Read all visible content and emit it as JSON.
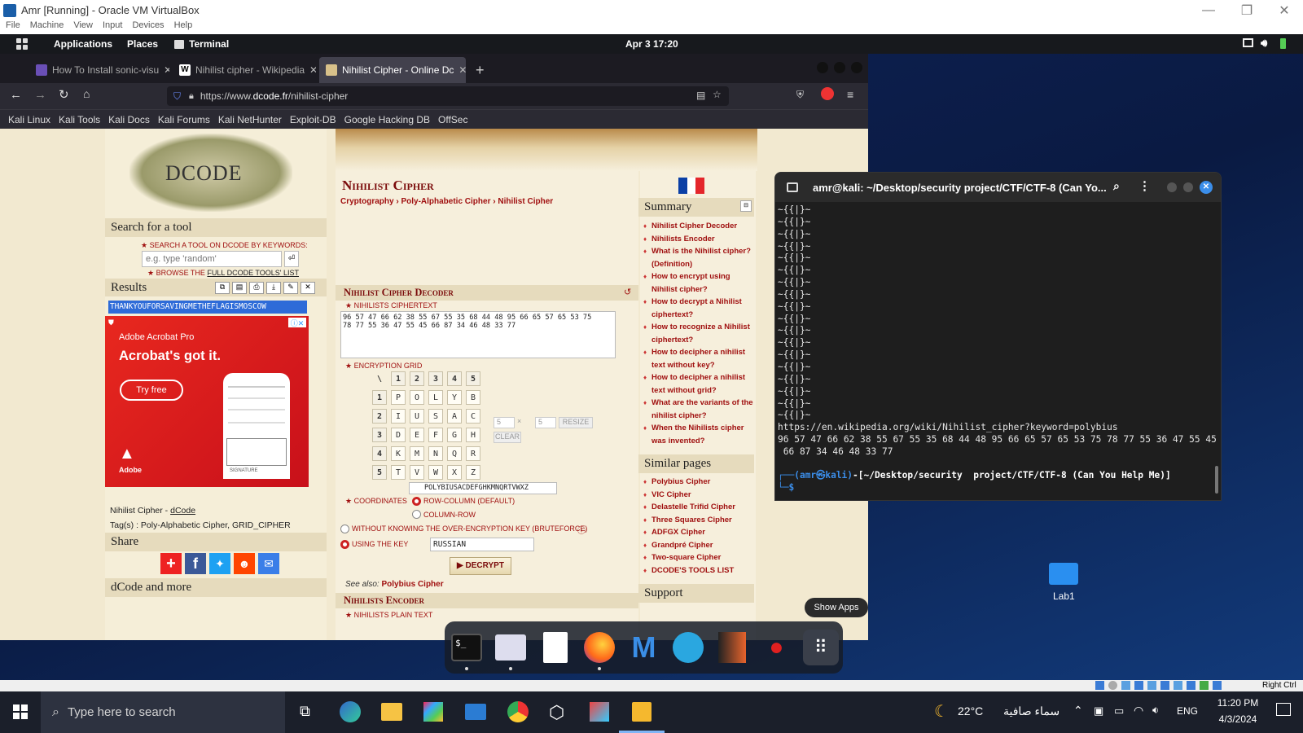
{
  "vbox": {
    "title": "Amr [Running] - Oracle VM VirtualBox",
    "menu": [
      "File",
      "Machine",
      "View",
      "Input",
      "Devices",
      "Help"
    ],
    "status_right": "Right Ctrl"
  },
  "kali_bar": {
    "applications": "Applications",
    "places": "Places",
    "terminal": "Terminal",
    "clock": "Apr 3  17:20"
  },
  "browser": {
    "tabs": [
      {
        "label": "How To Install sonic-visu",
        "active": false
      },
      {
        "label": "Nihilist cipher - Wikipedia",
        "active": false
      },
      {
        "label": "Nihilist Cipher - Online Dc",
        "active": true
      }
    ],
    "url_prefix": "https://www.",
    "url_domain": "dcode.fr",
    "url_path": "/nihilist-cipher",
    "bookmarks": [
      "Kali Linux",
      "Kali Tools",
      "Kali Docs",
      "Kali Forums",
      "Kali NetHunter",
      "Exploit-DB",
      "Google Hacking DB",
      "OffSec"
    ]
  },
  "dcode": {
    "logo_text": "DCODE",
    "search_title": "Search for a tool",
    "search_label": "★ Search a tool on dCode by keywords:",
    "search_placeholder": "e.g. type 'random'",
    "browse_label": "★ Browse the ",
    "browse_link": "full dCode tools' list",
    "results_title": "Results",
    "result_text": "THANKYOUFORSAVINGMETHEFLAGISMOSCOW",
    "ad": {
      "brand": "Adobe Acrobat Pro",
      "headline": "Acrobat's got it.",
      "cta": "Try free",
      "logo": "Adobe",
      "signature_label": "SIGNATURE"
    },
    "footer_prefix": "Nihilist Cipher - ",
    "footer_link": "dCode",
    "tags": "Tag(s) : Poly-Alphabetic Cipher, GRID_CIPHER",
    "share_title": "Share",
    "more_title": "dCode and more"
  },
  "main": {
    "title": "Nihilist Cipher",
    "breadcrumb": [
      "Cryptography",
      "Poly-Alphabetic Cipher",
      "Nihilist Cipher"
    ],
    "decoder_title": "Nihilist Cipher Decoder",
    "ciphertext_label": "★ Nihilists Ciphertext",
    "ciphertext": "96 57 47 66 62 38 55 67 55 35 68 44 48 95 66 65 57 65 53 75\n78 77 55 36 47 55 45 66 87 34 46 48 33 77",
    "grid_label": "★ Encryption Grid",
    "grid_corner": "\\",
    "grid_headers": [
      "1",
      "2",
      "3",
      "4",
      "5"
    ],
    "grid_rows": [
      [
        "P",
        "O",
        "L",
        "Y",
        "B"
      ],
      [
        "I",
        "U",
        "S",
        "A",
        "C"
      ],
      [
        "D",
        "E",
        "F",
        "G",
        "H"
      ],
      [
        "K",
        "M",
        "N",
        "Q",
        "R"
      ],
      [
        "T",
        "V",
        "W",
        "X",
        "Z"
      ]
    ],
    "grid_size_a": "5",
    "grid_size_b": "5",
    "resize_label": "RESIZE",
    "clear_label": "CLEAR",
    "alphabet": "POLYBIUSACDEFGHKMNQRTVWXZ",
    "coords_label": "★ Coordinates",
    "coord_opt1": "Row-Column (default)",
    "coord_opt2": "Column-Row",
    "without_key_label": "Without knowing the over-encryption key (bruteforce)",
    "using_key_label": "Using the key",
    "key_value": "RUSSIAN",
    "decrypt_label": "▶ DECRYPT",
    "see_also_prefix": "See also: ",
    "see_also_link": "Polybius Cipher",
    "encoder_title": "Nihilists Encoder",
    "plaintext_label": "★ Nihilists Plain Text"
  },
  "summary": {
    "title": "Summary",
    "items": [
      "Nihilist Cipher Decoder",
      "Nihilists Encoder",
      "What is the Nihilist cipher? (Definition)",
      "How to encrypt using Nihilist cipher?",
      "How to decrypt a Nihilist ciphertext?",
      "How to recognize a Nihilist ciphertext?",
      "How to decipher a nihilist text without key?",
      "How to decipher a nihilist text without grid?",
      "What are the variants of the nihilist cipher?",
      "When the Nihilists cipher was invented?"
    ],
    "similar_title": "Similar pages",
    "similar": [
      "Polybius Cipher",
      "VIC Cipher",
      "Delastelle Trifid Cipher",
      "Three Squares Cipher",
      "ADFGX Cipher",
      "Grandpré Cipher",
      "Two-square Cipher",
      "DCODE'S TOOLS LIST"
    ],
    "support_title": "Support"
  },
  "terminal": {
    "title": "amr@kali: ~/Desktop/security project/CTF/CTF-8 (Can Yo...",
    "repeat_line": "~{{|}~",
    "repeat_count": 18,
    "url_line": "https://en.wikipedia.org/wiki/Nihilist_cipher?keyword=polybius",
    "cipher_line1": "96 57 47 66 62 38 55 67 55 35 68 44 48 95 66 65 57 65 53 75 78 77 55 36 47 55 45",
    "cipher_line2": " 66 87 34 46 48 33 77",
    "prompt_user": "(amr㉿kali)",
    "prompt_path": "-[~/Desktop/security  project/CTF/CTF-8 (Can You Help Me)]",
    "prompt_symbol": "$"
  },
  "desktop": {
    "folder_label": "Lab1",
    "show_apps": "Show Apps"
  },
  "windows": {
    "search_placeholder": "Type here to search",
    "weather_temp": "22°C",
    "weather_text": "سماء صافية",
    "lang": "ENG",
    "time": "11:20 PM",
    "date": "4/3/2024"
  },
  "colors": {
    "dcode_red": "#a01010",
    "kali_blue": "#367bf0",
    "terminal_bg": "#1e1e1e"
  }
}
